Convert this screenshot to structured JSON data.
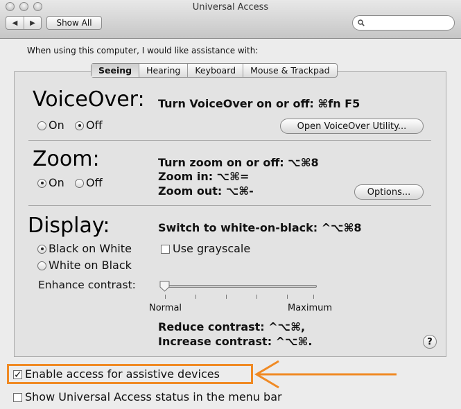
{
  "window": {
    "title": "Universal Access"
  },
  "toolbar": {
    "show_all": "Show All",
    "back_glyph": "◀",
    "forward_glyph": "▶"
  },
  "intro": "When using this computer, I would like assistance with:",
  "tabs": [
    "Seeing",
    "Hearing",
    "Keyboard",
    "Mouse & Trackpad"
  ],
  "voiceover": {
    "heading": "VoiceOver:",
    "shortcut": "Turn VoiceOver on or off: ⌘fn F5",
    "on_label": "On",
    "off_label": "Off",
    "selected": "Off",
    "utility_button": "Open VoiceOver Utility..."
  },
  "zoom": {
    "heading": "Zoom:",
    "toggle": "Turn zoom on or off: ⌥⌘8",
    "zoom_in": "Zoom in: ⌥⌘=",
    "zoom_out": "Zoom out: ⌥⌘-",
    "on_label": "On",
    "off_label": "Off",
    "selected": "On",
    "options_button": "Options..."
  },
  "display": {
    "heading": "Display:",
    "switch": "Switch to white-on-black: ^⌥⌘8",
    "black_on_white": "Black on White",
    "white_on_black": "White on Black",
    "selected": "Black on White",
    "grayscale": "Use grayscale",
    "grayscale_checked": false,
    "enhance_contrast": "Enhance contrast:",
    "slider_min": "Normal",
    "slider_max": "Maximum",
    "slider_value": 0,
    "reduce": "Reduce contrast: ^⌥⌘,",
    "increase": "Increase contrast: ^⌥⌘."
  },
  "help_glyph": "?",
  "footer": {
    "assistive": "Enable access for assistive devices",
    "assistive_checked": true,
    "status_menu": "Show Universal Access status in the menu bar",
    "status_menu_checked": false
  },
  "colors": {
    "highlight": "#f08a24"
  }
}
